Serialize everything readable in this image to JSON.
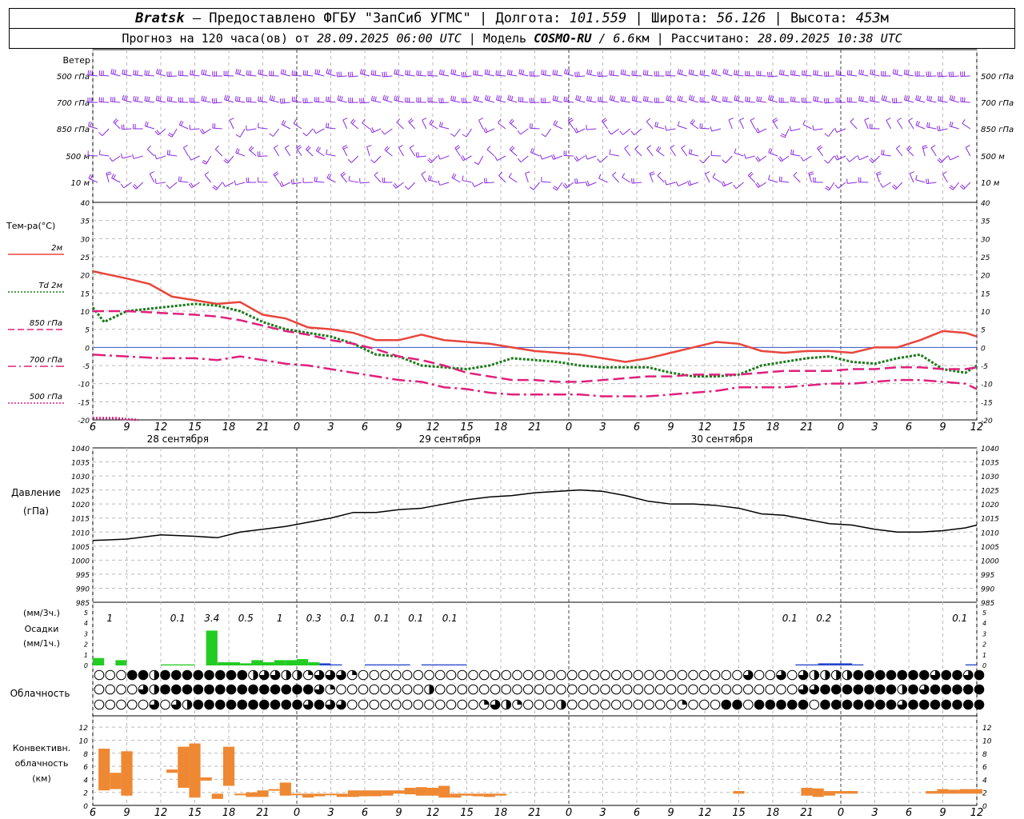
{
  "header": {
    "station": "Bratsk",
    "dash": " — ",
    "provider": "Предоставлено ФГБУ \"ЗапСиб УГМС\"",
    "sep": " | ",
    "lon_label": "Долгота: ",
    "lon": "101.559",
    "lat_label": "Широта: ",
    "lat": "56.126",
    "alt_label": "Высота: ",
    "alt": "453",
    "alt_unit": "м",
    "forecast_label": "Прогноз на 120 часа(ов) от ",
    "forecast_time": "28.09.2025 06:00 UTC",
    "model_label": "Модель ",
    "model": "COSMO-RU",
    "model_res": " / 6.6",
    "model_res_unit": "км",
    "calc_label": "Рассчитано: ",
    "calc_time": "28.09.2025 10:38 UTC"
  },
  "wind_panel": {
    "title": "Ветер",
    "levels": [
      "500 гПа",
      "700 гПа",
      "850 гПа",
      "500 м",
      "10  м"
    ]
  },
  "time_axis": {
    "hour_labels": [
      "6",
      "9",
      "12",
      "15",
      "18",
      "21",
      "0",
      "3",
      "6",
      "9",
      "12",
      "15",
      "18",
      "21",
      "0",
      "3",
      "6",
      "9",
      "12",
      "15",
      "18",
      "21",
      "0",
      "3",
      "6",
      "9",
      "12"
    ],
    "day_labels": [
      "28 сентября",
      "29 сентября",
      "30 сентября"
    ]
  },
  "temp_panel": {
    "title": "Тем-ра(°С)",
    "legend": [
      {
        "label": "2м",
        "color": "#e8453c",
        "style": "solid"
      },
      {
        "label": "Td  2м",
        "color": "#1a7a1a",
        "style": "dotted"
      },
      {
        "label": "850 гПа",
        "color": "#e0207c",
        "style": "dashed"
      },
      {
        "label": "700 гПа",
        "color": "#e0207c",
        "style": "dashdot"
      },
      {
        "label": "500 гПа",
        "color": "#e0207c",
        "style": "dotted"
      }
    ]
  },
  "pressure_panel": {
    "title": "Давление",
    "unit": "(гПа)"
  },
  "precip_panel": {
    "unit3": "(мм/3ч.)",
    "title": "Осадки",
    "unit1": "(мм/1ч.)",
    "labels": [
      {
        "h": 1.5,
        "text": "1"
      },
      {
        "h": 7.5,
        "text": "0.1"
      },
      {
        "h": 10.5,
        "text": "3.4"
      },
      {
        "h": 13.5,
        "text": "0.5"
      },
      {
        "h": 16.5,
        "text": "1"
      },
      {
        "h": 19.5,
        "text": "0.3"
      },
      {
        "h": 22.5,
        "text": "0.1"
      },
      {
        "h": 25.5,
        "text": "0.1"
      },
      {
        "h": 28.5,
        "text": "0.1"
      },
      {
        "h": 31.5,
        "text": "0.1"
      },
      {
        "h": 61.5,
        "text": "0.1"
      },
      {
        "h": 64.5,
        "text": "0.2"
      },
      {
        "h": 76.5,
        "text": "0.1"
      }
    ]
  },
  "cloud_panel": {
    "title": "Облачность"
  },
  "conv_panel": {
    "title1": "Конвективн.",
    "title2": "облачность",
    "unit": "(км)"
  },
  "colors": {
    "wind": "#8a2be2",
    "t2m": "#e8453c",
    "td": "#1a7a1a",
    "upper": "#e0207c",
    "rain": "#22cc22",
    "snow": "#2244cc",
    "conv": "#ee8833"
  },
  "chart_data": [
    {
      "type": "line",
      "title": "Тем-ра(°С)",
      "x_unit": "hours from 28.09.2025 06:00 UTC",
      "ylim": [
        -20,
        40
      ],
      "series": [
        {
          "name": "2м",
          "x": [
            0,
            3,
            5,
            7,
            9,
            11,
            13,
            15,
            17,
            19,
            21,
            23,
            25,
            27,
            29,
            31,
            33,
            35,
            37,
            39,
            41,
            43,
            45,
            47,
            49,
            51,
            53,
            55,
            57,
            59,
            61,
            63,
            65,
            67,
            69,
            71,
            73,
            75,
            77,
            78
          ],
          "values": [
            21,
            19,
            17.5,
            14,
            13,
            12,
            12.5,
            9,
            8,
            5.5,
            5,
            4,
            2,
            2,
            3.5,
            2,
            1.5,
            1,
            0,
            -1,
            -1.5,
            -2,
            -3,
            -4,
            -3,
            -1.5,
            0,
            1.5,
            1,
            -1,
            -1.5,
            -1,
            -1,
            -1.5,
            0,
            0,
            2,
            4.5,
            4,
            3
          ]
        },
        {
          "name": "Td  2м",
          "x": [
            0,
            1,
            3,
            6,
            9,
            11,
            13,
            15,
            17,
            19,
            21,
            23,
            25,
            27,
            29,
            31,
            33,
            35,
            37,
            39,
            41,
            43,
            45,
            47,
            49,
            51,
            53,
            55,
            57,
            59,
            61,
            63,
            65,
            67,
            69,
            71,
            73,
            75,
            77,
            78
          ],
          "values": [
            11,
            7,
            10,
            11,
            12,
            11.5,
            10,
            7,
            5,
            4,
            3,
            1,
            -2,
            -2.5,
            -5,
            -5.5,
            -6,
            -5,
            -3,
            -3.5,
            -4,
            -5,
            -5.5,
            -5.5,
            -5.5,
            -7,
            -8,
            -8,
            -7.5,
            -5,
            -4,
            -3,
            -2.5,
            -4,
            -4.5,
            -3,
            -2,
            -6,
            -7,
            -5
          ]
        },
        {
          "name": "850 гПа",
          "x": [
            0,
            3,
            6,
            9,
            11,
            13,
            15,
            17,
            19,
            21,
            23,
            25,
            27,
            29,
            31,
            33,
            35,
            37,
            39,
            41,
            43,
            45,
            47,
            49,
            51,
            53,
            55,
            57,
            59,
            61,
            63,
            65,
            67,
            69,
            71,
            73,
            75,
            77,
            78
          ],
          "values": [
            10,
            10,
            9.5,
            9,
            8.5,
            7.5,
            6,
            4.5,
            3.5,
            2,
            1,
            -0.5,
            -2.5,
            -3.5,
            -5,
            -7,
            -8,
            -9,
            -9,
            -9.5,
            -9.5,
            -9,
            -8.5,
            -8,
            -8,
            -7.5,
            -7.5,
            -7.5,
            -7,
            -6.5,
            -6.5,
            -6.5,
            -6,
            -6,
            -5.5,
            -5.5,
            -6,
            -6,
            -5.5
          ]
        },
        {
          "name": "700 гПа",
          "x": [
            0,
            3,
            6,
            9,
            11,
            13,
            15,
            17,
            19,
            21,
            23,
            25,
            27,
            29,
            31,
            33,
            35,
            37,
            39,
            41,
            43,
            45,
            47,
            49,
            51,
            53,
            55,
            57,
            59,
            61,
            63,
            65,
            67,
            69,
            71,
            73,
            75,
            77,
            78
          ],
          "values": [
            -2,
            -2.5,
            -3,
            -3,
            -3.5,
            -2.5,
            -3.5,
            -4.5,
            -5,
            -6,
            -7,
            -8,
            -9,
            -9.5,
            -11,
            -11.5,
            -12.5,
            -13,
            -13,
            -13,
            -13,
            -13.5,
            -13.5,
            -13.5,
            -13,
            -12.5,
            -12,
            -11,
            -11,
            -11,
            -10.5,
            -10,
            -10,
            -9.5,
            -9,
            -9,
            -9.5,
            -10,
            -11.5
          ]
        },
        {
          "name": "500 гПа",
          "x": [
            0,
            1,
            2,
            3,
            4
          ],
          "values": [
            -19.5,
            -19.5,
            -19.5,
            -19.8,
            -20
          ]
        }
      ]
    },
    {
      "type": "line",
      "title": "Давление",
      "ylabel": "(гПа)",
      "x_unit": "hours from 28.09.2025 06:00 UTC",
      "ylim": [
        985,
        1040
      ],
      "x": [
        0,
        3,
        6,
        9,
        11,
        13,
        15,
        17,
        19,
        21,
        23,
        25,
        27,
        29,
        31,
        33,
        35,
        37,
        39,
        41,
        43,
        45,
        47,
        49,
        51,
        53,
        55,
        57,
        59,
        61,
        63,
        65,
        67,
        69,
        71,
        73,
        75,
        77,
        78
      ],
      "values": [
        1007,
        1007.5,
        1009,
        1008.5,
        1008,
        1010,
        1011,
        1012,
        1013.5,
        1015,
        1017,
        1017,
        1018,
        1018.5,
        1020,
        1021.5,
        1022.5,
        1023,
        1024,
        1024.5,
        1025,
        1024.5,
        1023,
        1021,
        1020,
        1020,
        1019.5,
        1018.5,
        1016.5,
        1016,
        1014.5,
        1013,
        1012.5,
        1011,
        1010,
        1010,
        1010.5,
        1011.5,
        1012.5
      ]
    },
    {
      "type": "bar",
      "title": "Осадки",
      "ylabel": "(мм/1ч.)",
      "x_unit": "hours from 28.09.2025 06:00 UTC",
      "ylim": [
        0,
        5
      ],
      "x": [
        0,
        2,
        6,
        7,
        8,
        10,
        11,
        12,
        13,
        14,
        15,
        16,
        17,
        18,
        19,
        20,
        21,
        24,
        25,
        26,
        27,
        29,
        30,
        31,
        32,
        62,
        63,
        64,
        65,
        66,
        67,
        77
      ],
      "values": [
        0.7,
        0.5,
        0.1,
        0.1,
        0.1,
        3.3,
        0.3,
        0.3,
        0.2,
        0.5,
        0.3,
        0.5,
        0.5,
        0.6,
        0.3,
        0.2,
        0.1,
        0.1,
        0.1,
        0.1,
        0.1,
        0.1,
        0.1,
        0.1,
        0.1,
        0.1,
        0.1,
        0.2,
        0.2,
        0.2,
        0.1,
        0.1
      ],
      "kind": [
        "rain",
        "rain",
        "rain",
        "rain",
        "rain",
        "rain",
        "rain",
        "rain",
        "rain",
        "rain",
        "rain",
        "rain",
        "rain",
        "rain",
        "rain",
        "snow",
        "snow",
        "snow",
        "snow",
        "snow",
        "snow",
        "snow",
        "snow",
        "snow",
        "snow",
        "snow",
        "snow",
        "snow",
        "snow",
        "snow",
        "snow",
        "snow"
      ]
    },
    {
      "type": "table",
      "title": "Облачность",
      "x_unit": "hour index",
      "cover_levels_0_to_4": [
        [
          0,
          0,
          0,
          4,
          4,
          2,
          4,
          4,
          4,
          4,
          4,
          4,
          4,
          4,
          2,
          3,
          3,
          2,
          2,
          1,
          3,
          3,
          3,
          1,
          0,
          0,
          0,
          0,
          0,
          0,
          0,
          0,
          0,
          0,
          0,
          0,
          0,
          0,
          0,
          0,
          0,
          0,
          0,
          0,
          0,
          0,
          0,
          0,
          0,
          0,
          0,
          0,
          0,
          0,
          0,
          0,
          0,
          0,
          0,
          3,
          0,
          0,
          3,
          0,
          3,
          2,
          2,
          2,
          2,
          4,
          4,
          4,
          4,
          4,
          4,
          4,
          3,
          4,
          4,
          3,
          4
        ],
        [
          0,
          0,
          0,
          0,
          3,
          2,
          4,
          4,
          4,
          4,
          4,
          4,
          4,
          4,
          4,
          4,
          4,
          4,
          4,
          4,
          3,
          1,
          0,
          0,
          0,
          0,
          0,
          0,
          0,
          0,
          2,
          0,
          0,
          0,
          0,
          0,
          0,
          0,
          0,
          0,
          0,
          0,
          0,
          0,
          0,
          0,
          0,
          0,
          0,
          0,
          0,
          0,
          0,
          0,
          0,
          0,
          0,
          0,
          0,
          0,
          0,
          0,
          0,
          0,
          3,
          3,
          4,
          4,
          4,
          4,
          4,
          4,
          4,
          2,
          4,
          3,
          4,
          4,
          4,
          4,
          4
        ],
        [
          0,
          0,
          0,
          0,
          0,
          3,
          0,
          3,
          2,
          4,
          4,
          4,
          4,
          4,
          4,
          4,
          4,
          4,
          4,
          3,
          4,
          3,
          3,
          0,
          0,
          0,
          0,
          0,
          0,
          0,
          0,
          0,
          0,
          0,
          0,
          1,
          3,
          2,
          1,
          0,
          0,
          0,
          2,
          0,
          0,
          0,
          0,
          0,
          0,
          0,
          0,
          0,
          0,
          1,
          0,
          0,
          0,
          4,
          4,
          0,
          4,
          4,
          4,
          4,
          4,
          0,
          4,
          4,
          4,
          4,
          4,
          4,
          4,
          3,
          4,
          4,
          4,
          4,
          4,
          4,
          4
        ]
      ]
    },
    {
      "type": "bar",
      "title": "Конвективн. облачность",
      "ylabel": "(км)",
      "x_unit": "hours from 28.09.2025 06:00 UTC",
      "ylim": [
        0,
        13
      ],
      "x": [
        1,
        2,
        3,
        7,
        8,
        9,
        10,
        11,
        12,
        13,
        14,
        15,
        16,
        17,
        18,
        19,
        20,
        21,
        22,
        23,
        24,
        25,
        26,
        27,
        28,
        29,
        30,
        31,
        32,
        33,
        34,
        35,
        36,
        57,
        63,
        64,
        65,
        66,
        67,
        74,
        75,
        76,
        77,
        78
      ],
      "bottoms": [
        2.3,
        2.5,
        1.5,
        5,
        2.7,
        1.2,
        3.8,
        1,
        3,
        1.8,
        1.3,
        1.3,
        2.5,
        1.5,
        1.6,
        1.2,
        1.4,
        1.8,
        1.3,
        1.3,
        1.4,
        1.4,
        1.5,
        1.8,
        1.7,
        1.5,
        1.5,
        1.2,
        1.2,
        1.5,
        1.4,
        1.3,
        1.5,
        1.8,
        1.5,
        1.3,
        1.5,
        1.8,
        1.8,
        1.8,
        1.8,
        1.8,
        1.8,
        1.8
      ],
      "tops": [
        8.7,
        5,
        8.3,
        5.5,
        9,
        9.5,
        4.3,
        1.8,
        9,
        1.8,
        2,
        2.3,
        2.5,
        3.5,
        1.8,
        1.8,
        1.8,
        1.8,
        1.8,
        2.3,
        2.3,
        2.3,
        2.3,
        2.3,
        2.7,
        2.8,
        2.7,
        3,
        1.8,
        1.8,
        1.8,
        1.8,
        1.8,
        2.2,
        2.7,
        2.6,
        2.2,
        2.2,
        2.2,
        2.2,
        2.5,
        2.4,
        2.5,
        2.5
      ]
    }
  ]
}
